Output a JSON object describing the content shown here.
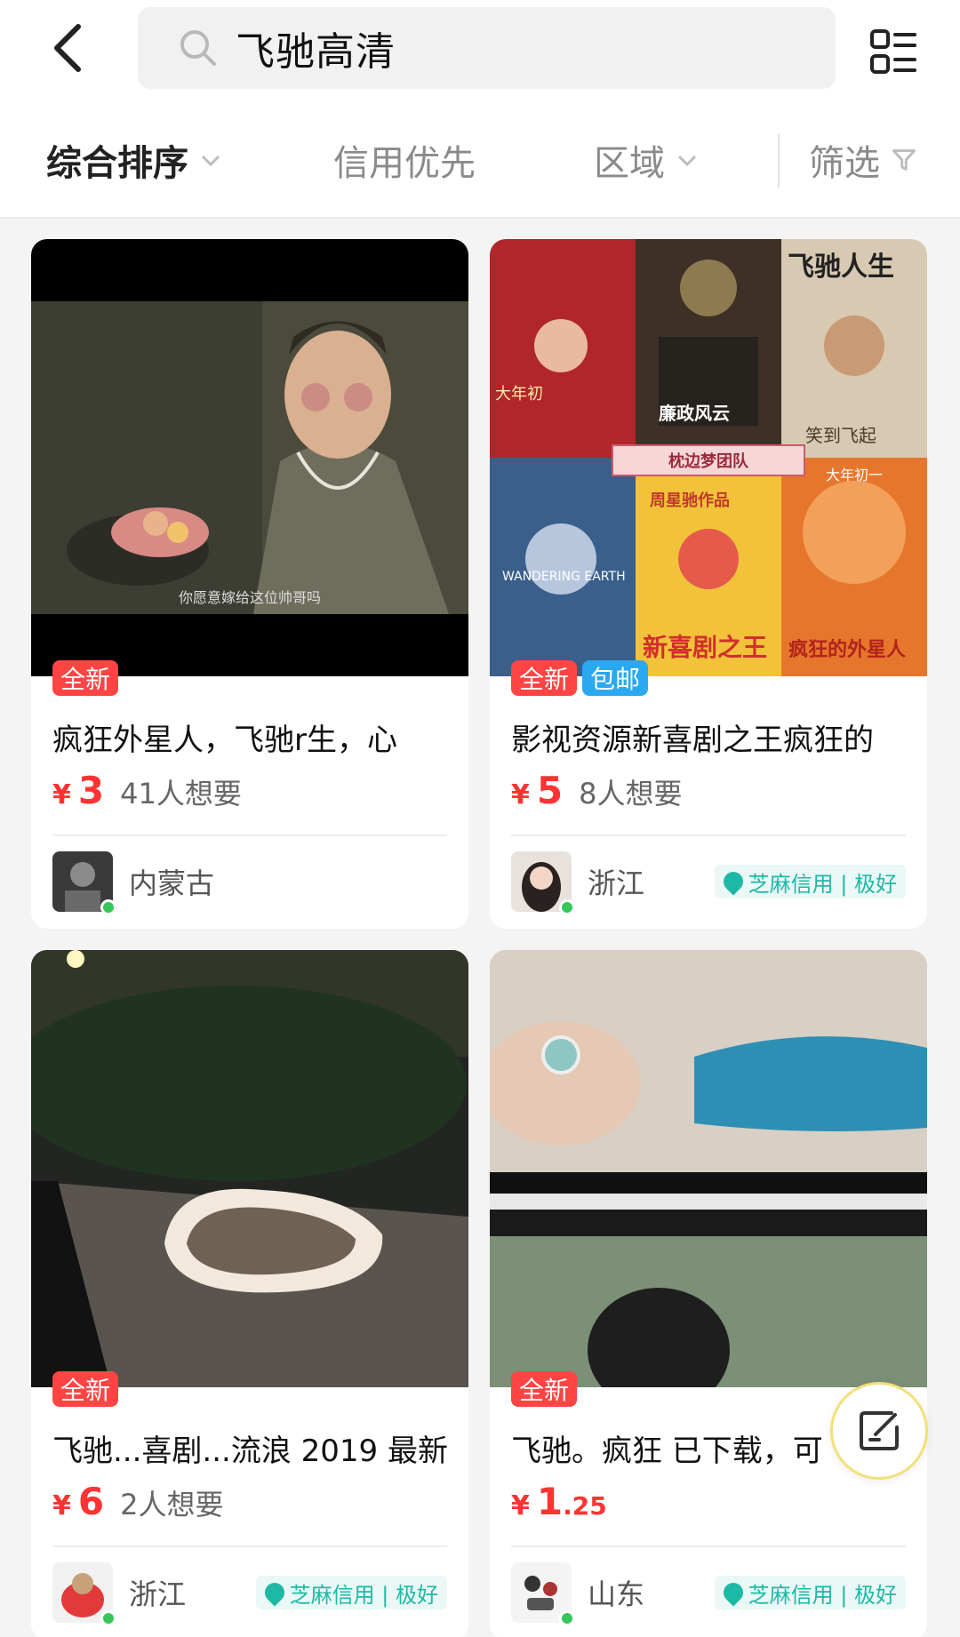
{
  "search": {
    "query": "飞驰高清"
  },
  "filters": [
    {
      "label": "综合排序",
      "active": true,
      "has_chevron": true
    },
    {
      "label": "信用优先",
      "active": false,
      "has_chevron": false
    },
    {
      "label": "区域",
      "active": false,
      "has_chevron": true
    },
    {
      "label": "筛选",
      "active": false,
      "icon": "funnel-icon"
    }
  ],
  "items": [
    {
      "tags": [
        "全新"
      ],
      "title": "疯狂外星人，飞驰r生，心",
      "price_yen": "¥",
      "price_int": "3",
      "price_dec": "",
      "wants": "41人想要",
      "region": "内蒙古",
      "credit": "",
      "thumb_caption": "你愿意嫁给这位帅哥吗"
    },
    {
      "tags": [
        "全新",
        "包邮"
      ],
      "title": "影视资源新喜剧之王疯狂的",
      "price_yen": "¥",
      "price_int": "5",
      "price_dec": "",
      "wants": "8人想要",
      "region": "浙江",
      "credit": "芝麻信用 | 极好",
      "posters": {
        "p1": "大年初",
        "p2": "廉政风云",
        "p3": "飞驰人生",
        "p3b": "笑到飞起",
        "banner": "枕边梦团队",
        "p4": "WANDERING EARTH",
        "p5a": "周星驰作品",
        "p5b": "新喜剧之王",
        "p6a": "大年初一",
        "p6b": "疯狂的外星人"
      }
    },
    {
      "tags": [
        "全新"
      ],
      "title": "飞驰...喜剧...流浪 2019 最新",
      "price_yen": "¥",
      "price_int": "6",
      "price_dec": "",
      "wants": "2人想要",
      "region": "浙江",
      "credit": "芝麻信用 | 极好"
    },
    {
      "tags": [
        "全新"
      ],
      "title": "飞驰。疯狂 已下载，可",
      "price_yen": "¥",
      "price_int": "1",
      "price_dec": ".25",
      "wants": "",
      "region": "山东",
      "credit": "芝麻信用 | 极好"
    }
  ],
  "colors": {
    "price": "#ff3333",
    "tag_new": "#ff4444",
    "tag_ship": "#2aa8f0",
    "credit": "#1eb9a6",
    "online": "#35c759"
  }
}
